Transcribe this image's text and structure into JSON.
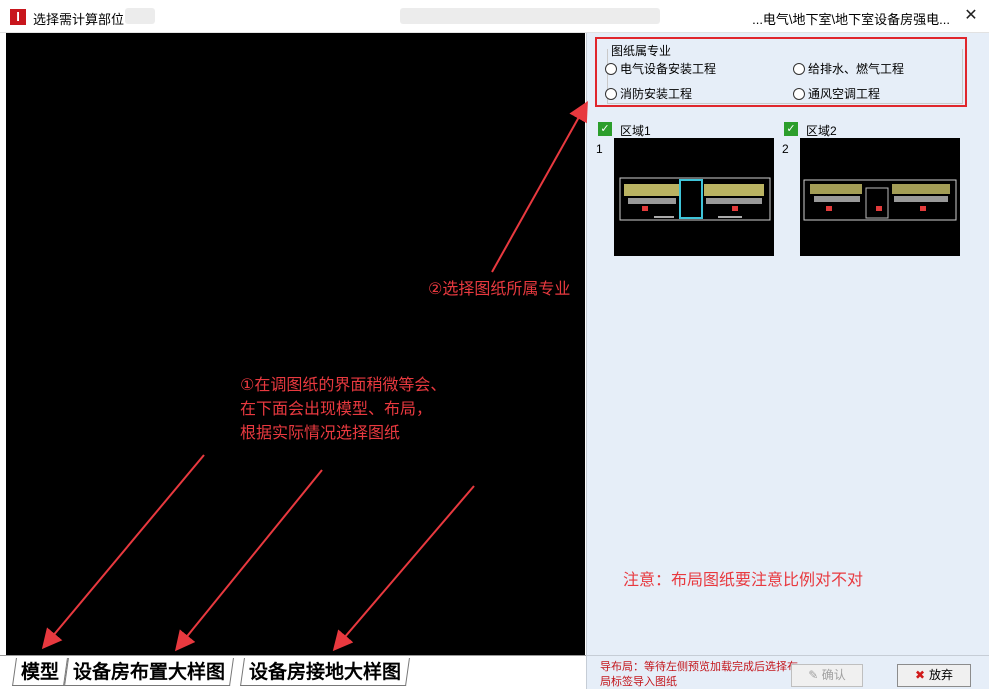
{
  "window": {
    "title": "选择需计算部位",
    "path": "...电气\\地下室\\地下室设备房强电...",
    "close_symbol": "✕"
  },
  "colors": {
    "accent_red": "#e8393f",
    "check_green": "#2c9e2c",
    "panel_bg": "#e6eef8"
  },
  "specialty": {
    "title": "图纸属专业",
    "options": [
      {
        "label": "电气设备安装工程",
        "selected": false
      },
      {
        "label": "给排水、燃气工程",
        "selected": false
      },
      {
        "label": "消防安装工程",
        "selected": false
      },
      {
        "label": "通风空调工程",
        "selected": false
      }
    ]
  },
  "regions": [
    {
      "index": "1",
      "label": "区域1",
      "checked": true
    },
    {
      "index": "2",
      "label": "区域2",
      "checked": true
    }
  ],
  "layout_tabs": [
    "模型",
    "设备房布置大样图",
    "设备房接地大样图"
  ],
  "annotations": {
    "step1_line1": "①在调图纸的界面稍微等会、",
    "step1_line2": "在下面会出现模型、布局，",
    "step1_line3": "根据实际情况选择图纸",
    "step2": "②选择图纸所属专业",
    "notice": "注意：布局图纸要注意比例对不对"
  },
  "status": {
    "text": "导布局：等待左侧预览加载完成后选择布局标签导入图纸",
    "ok_label": "确认",
    "cancel_label": "放弃"
  }
}
